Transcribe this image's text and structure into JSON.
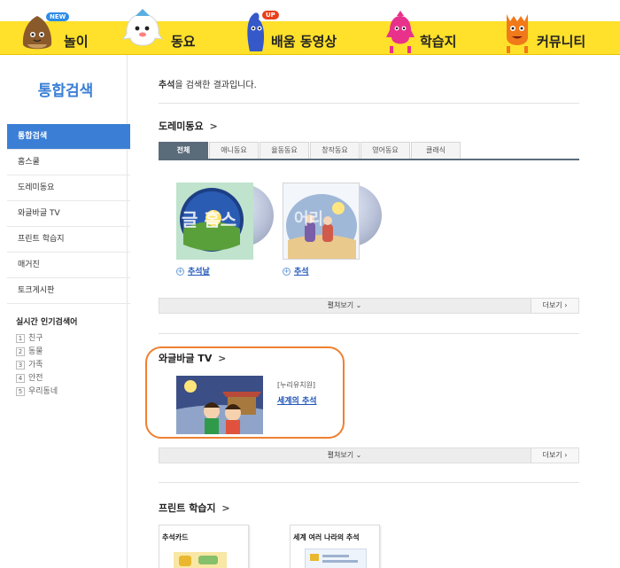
{
  "nav": {
    "items": [
      {
        "label": "놀이",
        "badge": "NEW"
      },
      {
        "label": "동요",
        "badge": ""
      },
      {
        "label": "배움 동영상",
        "badge": "UP"
      },
      {
        "label": "학습지",
        "badge": ""
      },
      {
        "label": "커뮤니티",
        "badge": ""
      }
    ]
  },
  "sidebar": {
    "title": "통합검색",
    "menu": [
      "통합검색",
      "홈스쿨",
      "도레미동요",
      "와글바글 TV",
      "프린트 학습지",
      "매거진",
      "토크게시판"
    ],
    "popular_title": "실시간 인기검색어",
    "popular": [
      {
        "num": "1",
        "term": "친구"
      },
      {
        "num": "2",
        "term": "동물"
      },
      {
        "num": "3",
        "term": "가족"
      },
      {
        "num": "4",
        "term": "안전"
      },
      {
        "num": "5",
        "term": "우리동네"
      }
    ]
  },
  "main": {
    "keyword": "추석",
    "result_suffix": "을 검색한 결과입니다.",
    "doremi": {
      "title": "도레미동요",
      "arrow": ">",
      "tabs": [
        "전체",
        "애니동요",
        "율동동요",
        "창작동요",
        "영어동요",
        "클래식"
      ],
      "items": [
        {
          "title": "추석날",
          "art_text": "글 홈스"
        },
        {
          "title": "추석",
          "art_text": "어리"
        }
      ],
      "expand_label": "펼쳐보기",
      "more_label": "더보기"
    },
    "waglebagle": {
      "title": "와글바글 TV",
      "arrow": ">",
      "category": "[누리유치원]",
      "video_title": "세계의 추석",
      "expand_label": "펼쳐보기",
      "more_label": "더보기"
    },
    "print": {
      "title": "프린트 학습지",
      "arrow": ">",
      "cards": [
        "추석카드",
        "세계 여러 나라의 추석"
      ]
    }
  }
}
